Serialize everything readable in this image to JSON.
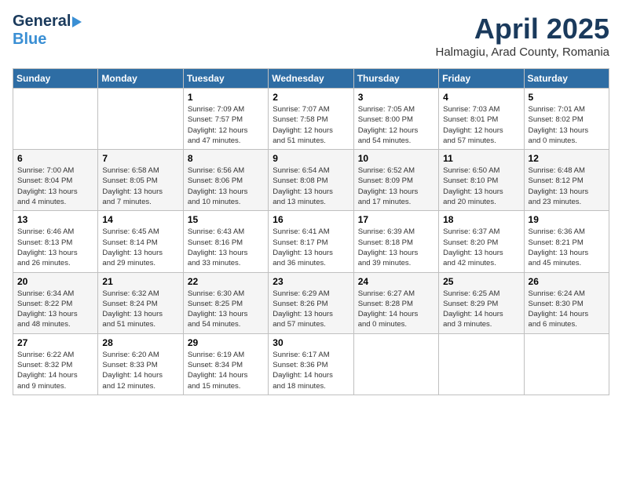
{
  "header": {
    "logo": {
      "general": "General",
      "blue": "Blue",
      "arrow": "▶"
    },
    "title": "April 2025",
    "subtitle": "Halmagiu, Arad County, Romania"
  },
  "days_of_week": [
    "Sunday",
    "Monday",
    "Tuesday",
    "Wednesday",
    "Thursday",
    "Friday",
    "Saturday"
  ],
  "weeks": [
    [
      {
        "day": "",
        "detail": ""
      },
      {
        "day": "",
        "detail": ""
      },
      {
        "day": "1",
        "detail": "Sunrise: 7:09 AM\nSunset: 7:57 PM\nDaylight: 12 hours\nand 47 minutes."
      },
      {
        "day": "2",
        "detail": "Sunrise: 7:07 AM\nSunset: 7:58 PM\nDaylight: 12 hours\nand 51 minutes."
      },
      {
        "day": "3",
        "detail": "Sunrise: 7:05 AM\nSunset: 8:00 PM\nDaylight: 12 hours\nand 54 minutes."
      },
      {
        "day": "4",
        "detail": "Sunrise: 7:03 AM\nSunset: 8:01 PM\nDaylight: 12 hours\nand 57 minutes."
      },
      {
        "day": "5",
        "detail": "Sunrise: 7:01 AM\nSunset: 8:02 PM\nDaylight: 13 hours\nand 0 minutes."
      }
    ],
    [
      {
        "day": "6",
        "detail": "Sunrise: 7:00 AM\nSunset: 8:04 PM\nDaylight: 13 hours\nand 4 minutes."
      },
      {
        "day": "7",
        "detail": "Sunrise: 6:58 AM\nSunset: 8:05 PM\nDaylight: 13 hours\nand 7 minutes."
      },
      {
        "day": "8",
        "detail": "Sunrise: 6:56 AM\nSunset: 8:06 PM\nDaylight: 13 hours\nand 10 minutes."
      },
      {
        "day": "9",
        "detail": "Sunrise: 6:54 AM\nSunset: 8:08 PM\nDaylight: 13 hours\nand 13 minutes."
      },
      {
        "day": "10",
        "detail": "Sunrise: 6:52 AM\nSunset: 8:09 PM\nDaylight: 13 hours\nand 17 minutes."
      },
      {
        "day": "11",
        "detail": "Sunrise: 6:50 AM\nSunset: 8:10 PM\nDaylight: 13 hours\nand 20 minutes."
      },
      {
        "day": "12",
        "detail": "Sunrise: 6:48 AM\nSunset: 8:12 PM\nDaylight: 13 hours\nand 23 minutes."
      }
    ],
    [
      {
        "day": "13",
        "detail": "Sunrise: 6:46 AM\nSunset: 8:13 PM\nDaylight: 13 hours\nand 26 minutes."
      },
      {
        "day": "14",
        "detail": "Sunrise: 6:45 AM\nSunset: 8:14 PM\nDaylight: 13 hours\nand 29 minutes."
      },
      {
        "day": "15",
        "detail": "Sunrise: 6:43 AM\nSunset: 8:16 PM\nDaylight: 13 hours\nand 33 minutes."
      },
      {
        "day": "16",
        "detail": "Sunrise: 6:41 AM\nSunset: 8:17 PM\nDaylight: 13 hours\nand 36 minutes."
      },
      {
        "day": "17",
        "detail": "Sunrise: 6:39 AM\nSunset: 8:18 PM\nDaylight: 13 hours\nand 39 minutes."
      },
      {
        "day": "18",
        "detail": "Sunrise: 6:37 AM\nSunset: 8:20 PM\nDaylight: 13 hours\nand 42 minutes."
      },
      {
        "day": "19",
        "detail": "Sunrise: 6:36 AM\nSunset: 8:21 PM\nDaylight: 13 hours\nand 45 minutes."
      }
    ],
    [
      {
        "day": "20",
        "detail": "Sunrise: 6:34 AM\nSunset: 8:22 PM\nDaylight: 13 hours\nand 48 minutes."
      },
      {
        "day": "21",
        "detail": "Sunrise: 6:32 AM\nSunset: 8:24 PM\nDaylight: 13 hours\nand 51 minutes."
      },
      {
        "day": "22",
        "detail": "Sunrise: 6:30 AM\nSunset: 8:25 PM\nDaylight: 13 hours\nand 54 minutes."
      },
      {
        "day": "23",
        "detail": "Sunrise: 6:29 AM\nSunset: 8:26 PM\nDaylight: 13 hours\nand 57 minutes."
      },
      {
        "day": "24",
        "detail": "Sunrise: 6:27 AM\nSunset: 8:28 PM\nDaylight: 14 hours\nand 0 minutes."
      },
      {
        "day": "25",
        "detail": "Sunrise: 6:25 AM\nSunset: 8:29 PM\nDaylight: 14 hours\nand 3 minutes."
      },
      {
        "day": "26",
        "detail": "Sunrise: 6:24 AM\nSunset: 8:30 PM\nDaylight: 14 hours\nand 6 minutes."
      }
    ],
    [
      {
        "day": "27",
        "detail": "Sunrise: 6:22 AM\nSunset: 8:32 PM\nDaylight: 14 hours\nand 9 minutes."
      },
      {
        "day": "28",
        "detail": "Sunrise: 6:20 AM\nSunset: 8:33 PM\nDaylight: 14 hours\nand 12 minutes."
      },
      {
        "day": "29",
        "detail": "Sunrise: 6:19 AM\nSunset: 8:34 PM\nDaylight: 14 hours\nand 15 minutes."
      },
      {
        "day": "30",
        "detail": "Sunrise: 6:17 AM\nSunset: 8:36 PM\nDaylight: 14 hours\nand 18 minutes."
      },
      {
        "day": "",
        "detail": ""
      },
      {
        "day": "",
        "detail": ""
      },
      {
        "day": "",
        "detail": ""
      }
    ]
  ]
}
